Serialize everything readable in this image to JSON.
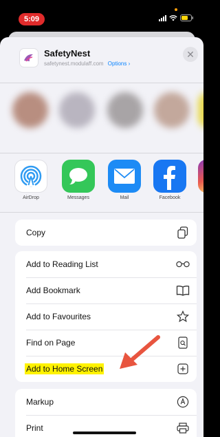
{
  "status": {
    "time": "5:09"
  },
  "share_header": {
    "title": "SafetyNest",
    "subtitle": "safetynest.modulaff.com",
    "options_label": "Options",
    "options_chevron": "›",
    "close_glyph": "✕"
  },
  "apps": [
    {
      "label": "AirDrop",
      "icon": "airdrop-icon"
    },
    {
      "label": "Messages",
      "icon": "messages-icon"
    },
    {
      "label": "Mail",
      "icon": "mail-icon"
    },
    {
      "label": "Facebook",
      "icon": "facebook-icon"
    }
  ],
  "actions": {
    "copy": "Copy",
    "reading_list": "Add to Reading List",
    "bookmark": "Add Bookmark",
    "favourites": "Add to Favourites",
    "find": "Find on Page",
    "home_screen": "Add to Home Screen",
    "markup": "Markup",
    "print": "Print"
  },
  "colors": {
    "highlight": "#fff200",
    "arrow": "#e8553f",
    "time_pill": "#e02b2b"
  }
}
